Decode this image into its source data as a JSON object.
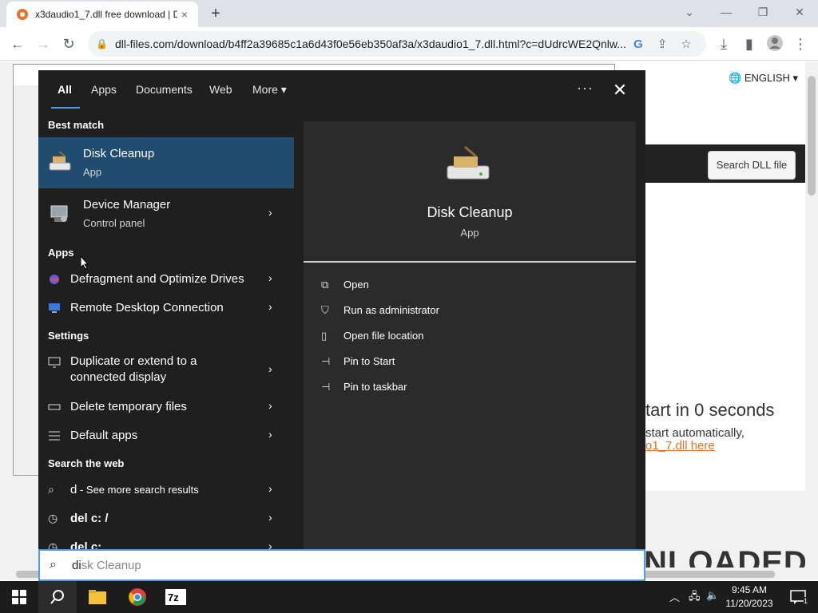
{
  "browser": {
    "tab_title": "x3daudio1_7.dll free download | D",
    "url": "dll-files.com/download/b4ff2a39685c1a6d43f0e56eb350af3a/x3daudio1_7.dll.html?c=dUdrcWE2Qnlw...",
    "tab_close": "×",
    "new_tab": "+"
  },
  "page": {
    "language": "ENGLISH",
    "search_button": "Search DLL file",
    "start_text": "tart in 0 seconds",
    "auto_text": "start automatically,",
    "dll_link": "o1_7.dll here",
    "loaded": "NLOADED"
  },
  "search_panel": {
    "tabs": [
      {
        "label": "All"
      },
      {
        "label": "Apps"
      },
      {
        "label": "Documents"
      },
      {
        "label": "Web"
      },
      {
        "label": "More"
      }
    ],
    "best_match_header": "Best match",
    "best_match": {
      "title": "Disk Cleanup",
      "subtitle": "App"
    },
    "device_manager": {
      "title": "Device Manager",
      "subtitle": "Control panel"
    },
    "apps_header": "Apps",
    "apps": [
      {
        "label": "Defragment and Optimize Drives"
      },
      {
        "label": "Remote Desktop Connection"
      }
    ],
    "settings_header": "Settings",
    "settings": [
      {
        "label_line1": "Duplicate or extend to a",
        "label_line2": "connected display"
      },
      {
        "label": "Delete temporary files"
      },
      {
        "label": "Default apps"
      }
    ],
    "web_header": "Search the web",
    "web": [
      {
        "label": "d",
        "suffix": " - See more search results"
      },
      {
        "label": "del c: /"
      },
      {
        "label": "del c:"
      }
    ],
    "preview": {
      "title": "Disk Cleanup",
      "subtitle": "App",
      "actions": [
        {
          "label": "Open",
          "icon": "open-icon"
        },
        {
          "label": "Run as administrator",
          "icon": "shield-icon"
        },
        {
          "label": "Open file location",
          "icon": "file-icon"
        },
        {
          "label": "Pin to Start",
          "icon": "pin-icon"
        },
        {
          "label": "Pin to taskbar",
          "icon": "pin-icon"
        }
      ]
    },
    "query_typed": "di",
    "query_hint": "sk Cleanup"
  },
  "taskbar": {
    "time": "9:45 AM",
    "date": "11/20/2023",
    "notification_count": "1"
  },
  "colors": {
    "accent": "#4c9de8",
    "selection": "#1f4c6f",
    "panel_bg": "#1f1f1f"
  }
}
